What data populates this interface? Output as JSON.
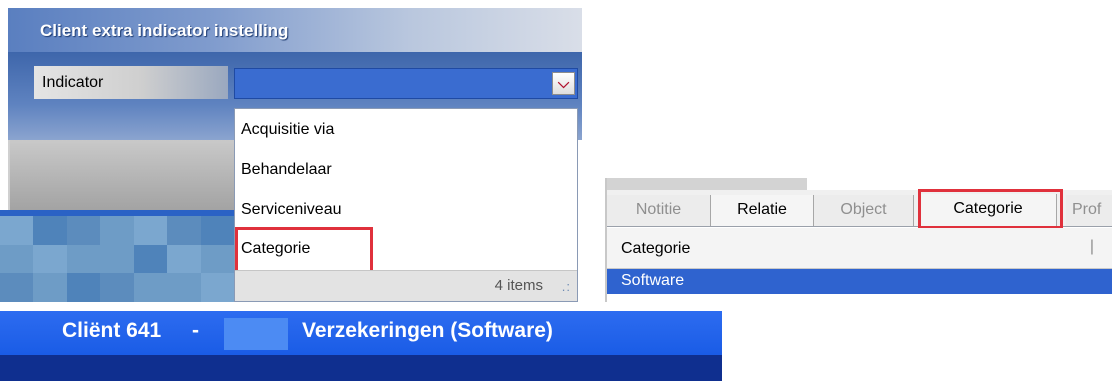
{
  "indicator_dialog": {
    "title": "Client extra indicator instelling",
    "field_label": "Indicator",
    "selected_value": "",
    "dropdown": {
      "options": [
        "Acquisitie via",
        "Behandelaar",
        "Serviceniveau",
        "Categorie"
      ],
      "highlighted_option": "Categorie",
      "count_label": "4 items"
    }
  },
  "relation_tabs": {
    "tabs": [
      "Notitie",
      "Relatie",
      "Object",
      "Categorie",
      "Prof"
    ],
    "active_tab": "Categorie",
    "grid": {
      "column_header": "Categorie",
      "rows": [
        "Software"
      ]
    }
  },
  "client_titlebar": {
    "client_label": "Cliënt 641",
    "separator": "-",
    "client_name": "Verzekeringen (Software)"
  },
  "colors": {
    "highlight_border": "#e0313c",
    "selection_blue": "#2f63cf",
    "titlebar_blue": "#1d5de6",
    "dropdown_arrow": "#b0122e"
  }
}
